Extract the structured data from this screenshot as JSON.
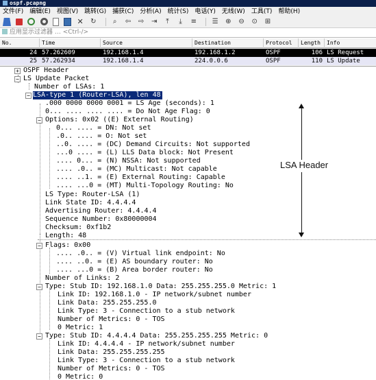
{
  "window": {
    "title": "ospf.pcapng"
  },
  "menu": [
    "文件(F)",
    "编辑(E)",
    "视图(V)",
    "跳转(G)",
    "捕获(C)",
    "分析(A)",
    "统计(S)",
    "电话(Y)",
    "无线(W)",
    "工具(T)",
    "帮助(H)"
  ],
  "filter": {
    "placeholder": "应用显示过滤器 … <Ctrl-/>"
  },
  "packet_list": {
    "columns": [
      "No.",
      "Time",
      "Source",
      "Destination",
      "Protocol",
      "Length",
      "Info"
    ],
    "rows": [
      {
        "no": "24",
        "time": "57.262609",
        "source": "192.168.1.4",
        "destination": "192.168.1.2",
        "protocol": "OSPF",
        "length": "106",
        "info": "LS Request",
        "selected": true
      },
      {
        "no": "25",
        "time": "57.262934",
        "source": "192.168.1.4",
        "destination": "224.0.0.6",
        "protocol": "OSPF",
        "length": "110",
        "info": "LS Update",
        "selected": false
      }
    ]
  },
  "details": [
    {
      "text": "OSPF Header",
      "toggle": "+"
    },
    {
      "text": "LS Update Packet",
      "toggle": "-"
    },
    {
      "text": "Number of LSAs: 1"
    },
    {
      "text": "LSA-type 1 (Router-LSA), len 48",
      "toggle": "-",
      "highlight": true
    },
    {
      "text": ".000 0000 0000 0001 = LS Age (seconds): 1"
    },
    {
      "text": "0... .... .... .... = Do Not Age Flag: 0"
    },
    {
      "text": "Options: 0x02 ((E) External Routing)",
      "toggle": "-"
    },
    {
      "text": "0... .... = DN: Not set"
    },
    {
      "text": ".0.. .... = O: Not set"
    },
    {
      "text": "..0. .... = (DC) Demand Circuits: Not supported"
    },
    {
      "text": "...0 .... = (L) LLS Data block: Not Present"
    },
    {
      "text": ".... 0... = (N) NSSA: Not supported"
    },
    {
      "text": ".... .0.. = (MC) Multicast: Not capable"
    },
    {
      "text": ".... ..1. = (E) External Routing: Capable"
    },
    {
      "text": ".... ...0 = (MT) Multi-Topology Routing: No"
    },
    {
      "text": "LS Type: Router-LSA (1)"
    },
    {
      "text": "Link State ID: 4.4.4.4"
    },
    {
      "text": "Advertising Router: 4.4.4.4"
    },
    {
      "text": "Sequence Number: 0x80000004"
    },
    {
      "text": "Checksum: 0xf1b2"
    },
    {
      "text": "Length: 48"
    },
    {
      "text": "Flags: 0x00",
      "toggle": "-"
    },
    {
      "text": ".... .0.. = (V) Virtual link endpoint: No"
    },
    {
      "text": ".... ..0. = (E) AS boundary router: No"
    },
    {
      "text": ".... ...0 = (B) Area border router: No"
    },
    {
      "text": "Number of Links: 2"
    },
    {
      "text": "Type: Stub     ID: 192.168.1.0     Data: 255.255.255.0   Metric: 1",
      "toggle": "-"
    },
    {
      "text": "Link ID: 192.168.1.0 - IP network/subnet number"
    },
    {
      "text": "Link Data: 255.255.255.0"
    },
    {
      "text": "Link Type: 3 - Connection to a stub network"
    },
    {
      "text": "Number of Metrics: 0 - TOS"
    },
    {
      "text": "0 Metric: 1"
    },
    {
      "text": "Type: Stub     ID: 4.4.4.4         Data: 255.255.255.255 Metric: 0",
      "toggle": "-"
    },
    {
      "text": "Link ID: 4.4.4.4 - IP network/subnet number"
    },
    {
      "text": "Link Data: 255.255.255.255"
    },
    {
      "text": "Link Type: 3 - Connection to a stub network"
    },
    {
      "text": "Number of Metrics: 0 - TOS"
    },
    {
      "text": "0 Metric: 0"
    }
  ],
  "annotation": {
    "label": "LSA Header"
  }
}
